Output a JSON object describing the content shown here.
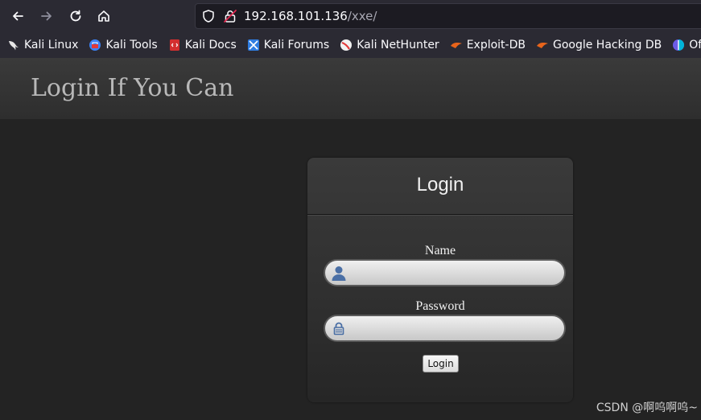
{
  "browser": {
    "url_host": "192.168.101.136",
    "url_path": "/xxe/",
    "nav_icons": [
      "back-icon",
      "forward-icon",
      "reload-icon",
      "home-icon"
    ],
    "bookmarks": [
      {
        "label": "Kali Linux",
        "icon": "kali-dragon-icon",
        "color": "#e6e6e6"
      },
      {
        "label": "Kali Tools",
        "icon": "kali-tools-icon",
        "color": "#3b82f6"
      },
      {
        "label": "Kali Docs",
        "icon": "kali-docs-icon",
        "color": "#d32f2f"
      },
      {
        "label": "Kali Forums",
        "icon": "kali-forums-icon",
        "color": "#2f7de1"
      },
      {
        "label": "Kali NetHunter",
        "icon": "kali-nethunter-icon",
        "color": "#e23a3a"
      },
      {
        "label": "Exploit-DB",
        "icon": "exploit-db-icon",
        "color": "#e8641b"
      },
      {
        "label": "Google Hacking DB",
        "icon": "google-hacking-db-icon",
        "color": "#e8641b"
      },
      {
        "label": "OffSec",
        "icon": "offsec-icon",
        "color": "#6c5ce7"
      }
    ]
  },
  "page": {
    "title": "Login If You Can"
  },
  "login_card": {
    "title": "Login",
    "name_label": "Name",
    "name_value": "",
    "name_placeholder": "",
    "password_label": "Password",
    "password_value": "",
    "password_placeholder": "",
    "submit_label": "Login"
  },
  "watermark": "CSDN @啊呜啊呜~",
  "colors": {
    "page_background": "#232323",
    "header_background": "#363636",
    "card_background": "#333333",
    "icon_blue": "#4a6fa5"
  }
}
